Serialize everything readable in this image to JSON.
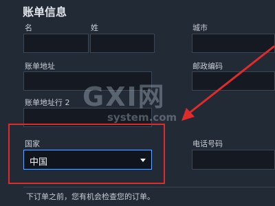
{
  "section": {
    "title": "账单信息"
  },
  "labels": {
    "first_name": "名",
    "last_name": "姓",
    "city": "城市",
    "billing_address": "账单地址",
    "postal_code": "邮政编码",
    "billing_address_2": "账单地址行 2",
    "country": "国家",
    "phone": "电话号码"
  },
  "country_select": {
    "value": "中国"
  },
  "footer": {
    "text": "下订单之前，您有机会检查您的订单。"
  },
  "watermark": {
    "main": "GXI网",
    "sub": "system.com"
  },
  "colors": {
    "highlight": "#e02b2b",
    "focus": "#67a8ff",
    "background": "#222a36"
  }
}
